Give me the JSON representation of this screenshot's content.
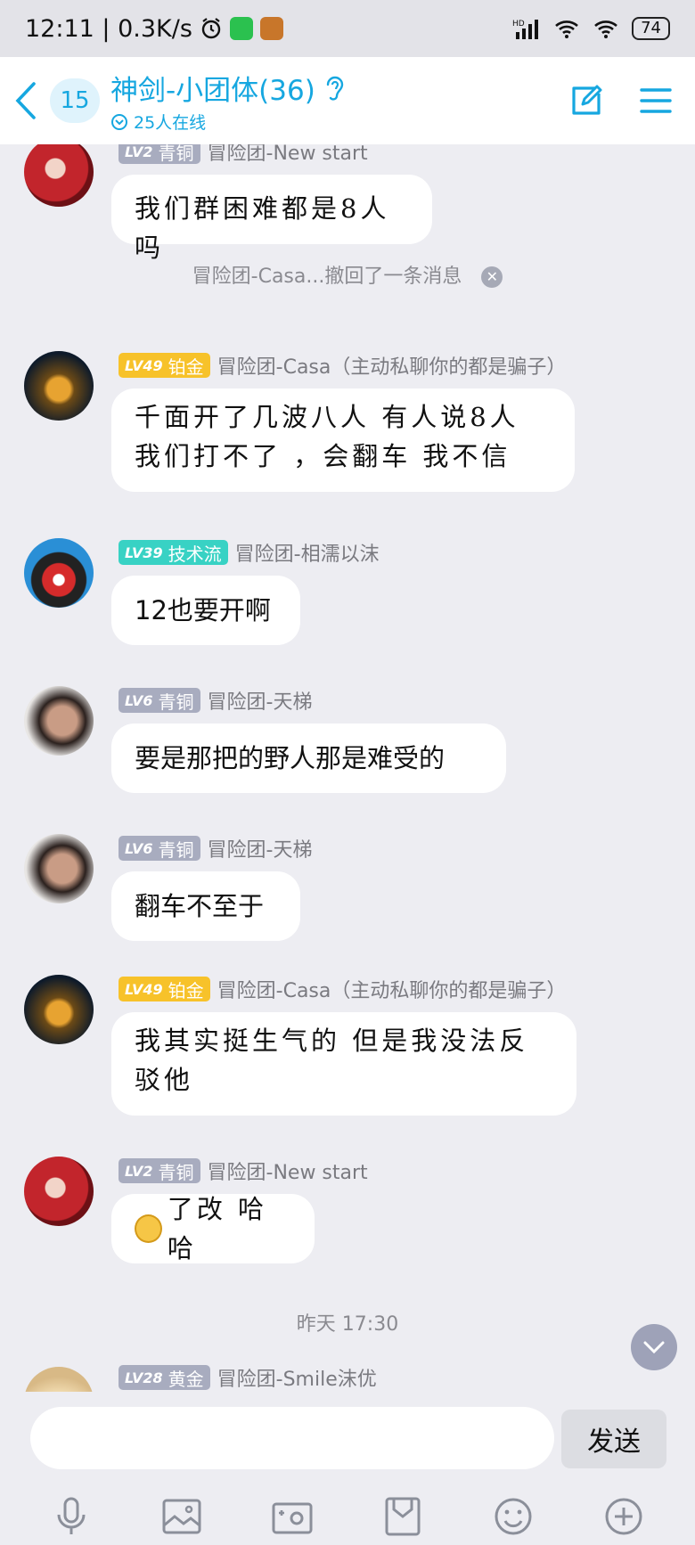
{
  "status_bar": {
    "time_speed": "12:11 | 0.3K/s",
    "battery": "74",
    "network_label": "HD"
  },
  "header": {
    "back_label": "back",
    "unread_count": "15",
    "title": "神剑-小团体(36)",
    "online": "25人在线"
  },
  "messages": [
    {
      "level": "LV2",
      "rank": "青铜",
      "name": "冒险团-New start",
      "text": "我们群困难都是8人吗",
      "badge_color": "#a8acbf"
    },
    {
      "system": "冒险团-Casa...撤回了一条消息"
    },
    {
      "level": "LV49",
      "rank": "铂金",
      "name": "冒险团-Casa（主动私聊你的都是骗子）",
      "text": "千面开了几波八人 有人说8人 我们打不了 ，会翻车 我不信",
      "badge_color": "#f7c22a"
    },
    {
      "level": "LV39",
      "rank": "技术流",
      "name": "冒险团-相濡以沫",
      "text": "12也要开啊",
      "badge_color": "#38d2c4"
    },
    {
      "level": "LV6",
      "rank": "青铜",
      "name": "冒险团-天梯",
      "text": "要是那把的野人那是难受的",
      "badge_color": "#a8acbf"
    },
    {
      "level": "LV6",
      "rank": "青铜",
      "name": "冒险团-天梯",
      "text": "翻车不至于",
      "badge_color": "#a8acbf"
    },
    {
      "level": "LV49",
      "rank": "铂金",
      "name": "冒险团-Casa（主动私聊你的都是骗子）",
      "text": "我其实挺生气的 但是我没法反驳他",
      "badge_color": "#f7c22a"
    },
    {
      "level": "LV2",
      "rank": "青铜",
      "name": "冒险团-New start",
      "text": "了改 哈哈",
      "badge_color": "#a8acbf"
    },
    {
      "system": "昨天 17:30"
    },
    {
      "level": "LV28",
      "rank": "黄金",
      "name": "冒险团-Smile沫优",
      "badge_color": "#a8acbf"
    }
  ],
  "input": {
    "placeholder": "",
    "send_label": "发送"
  },
  "toolbar_icons": [
    "mic-icon",
    "image-icon",
    "camera-icon",
    "file-icon",
    "emoji-icon",
    "plus-icon"
  ],
  "colors": {
    "accent": "#16a7e0",
    "background": "#ededf2",
    "bubble": "#ffffff"
  }
}
